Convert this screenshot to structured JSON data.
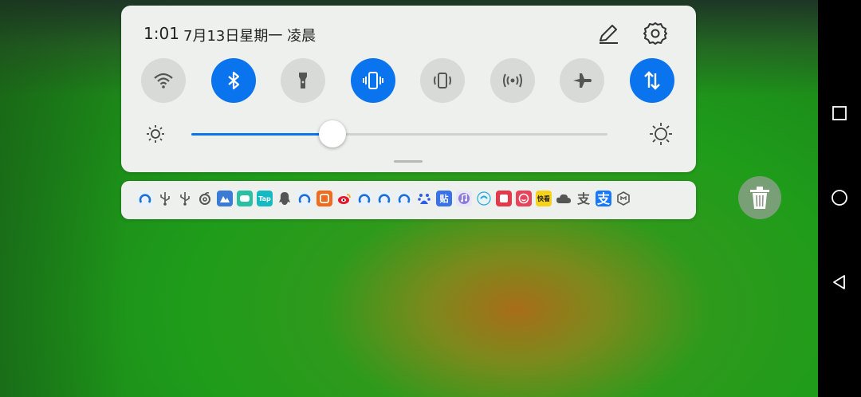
{
  "status": {
    "time": "1:01",
    "date": "7月13日星期一 凌晨"
  },
  "toggles": [
    {
      "name": "wifi",
      "icon": "wifi-icon",
      "on": false
    },
    {
      "name": "bluetooth",
      "icon": "bluetooth-icon",
      "on": true
    },
    {
      "name": "flashlight",
      "icon": "flashlight-icon",
      "on": false
    },
    {
      "name": "vibrate",
      "icon": "vibrate-icon",
      "on": true
    },
    {
      "name": "auto-rotate",
      "icon": "rotate-icon",
      "on": false
    },
    {
      "name": "hotspot",
      "icon": "hotspot-icon",
      "on": false
    },
    {
      "name": "airplane",
      "icon": "airplane-icon",
      "on": false
    },
    {
      "name": "mobile-data",
      "icon": "mobile-data-icon",
      "on": true
    }
  ],
  "brightness": {
    "level": 0.34
  },
  "colors": {
    "accent": "#0a73ee",
    "panel": "#eef0ee",
    "toggle_off": "#d8dad8"
  },
  "notification_icons": [
    {
      "icon": "app-arc-icon",
      "text": ""
    },
    {
      "icon": "usb-icon",
      "text": ""
    },
    {
      "icon": "usb-icon",
      "text": ""
    },
    {
      "icon": "netease-music-icon",
      "text": ""
    },
    {
      "icon": "app-blue-triangle-icon",
      "text": ""
    },
    {
      "icon": "app-green-badge-icon",
      "text": ""
    },
    {
      "icon": "taptap-icon",
      "text": "Tap"
    },
    {
      "icon": "qq-icon",
      "text": ""
    },
    {
      "icon": "app-arc-icon",
      "text": ""
    },
    {
      "icon": "taobao-icon",
      "text": ""
    },
    {
      "icon": "weibo-icon",
      "text": ""
    },
    {
      "icon": "app-arc-icon",
      "text": ""
    },
    {
      "icon": "app-arc-icon",
      "text": ""
    },
    {
      "icon": "app-arc-icon",
      "text": ""
    },
    {
      "icon": "baidu-icon",
      "text": ""
    },
    {
      "icon": "tieba-icon",
      "text": "贴"
    },
    {
      "icon": "music-icon",
      "text": ""
    },
    {
      "icon": "app-round-icon",
      "text": ""
    },
    {
      "icon": "app-red-square-icon",
      "text": ""
    },
    {
      "icon": "app-red-face-icon",
      "text": ""
    },
    {
      "icon": "kuaikan-icon",
      "text": "快看"
    },
    {
      "icon": "cloud-icon",
      "text": ""
    },
    {
      "icon": "alipay-outline-icon",
      "text": ""
    },
    {
      "icon": "alipay-icon",
      "text": ""
    },
    {
      "icon": "app-hexagon-icon",
      "text": ""
    }
  ]
}
